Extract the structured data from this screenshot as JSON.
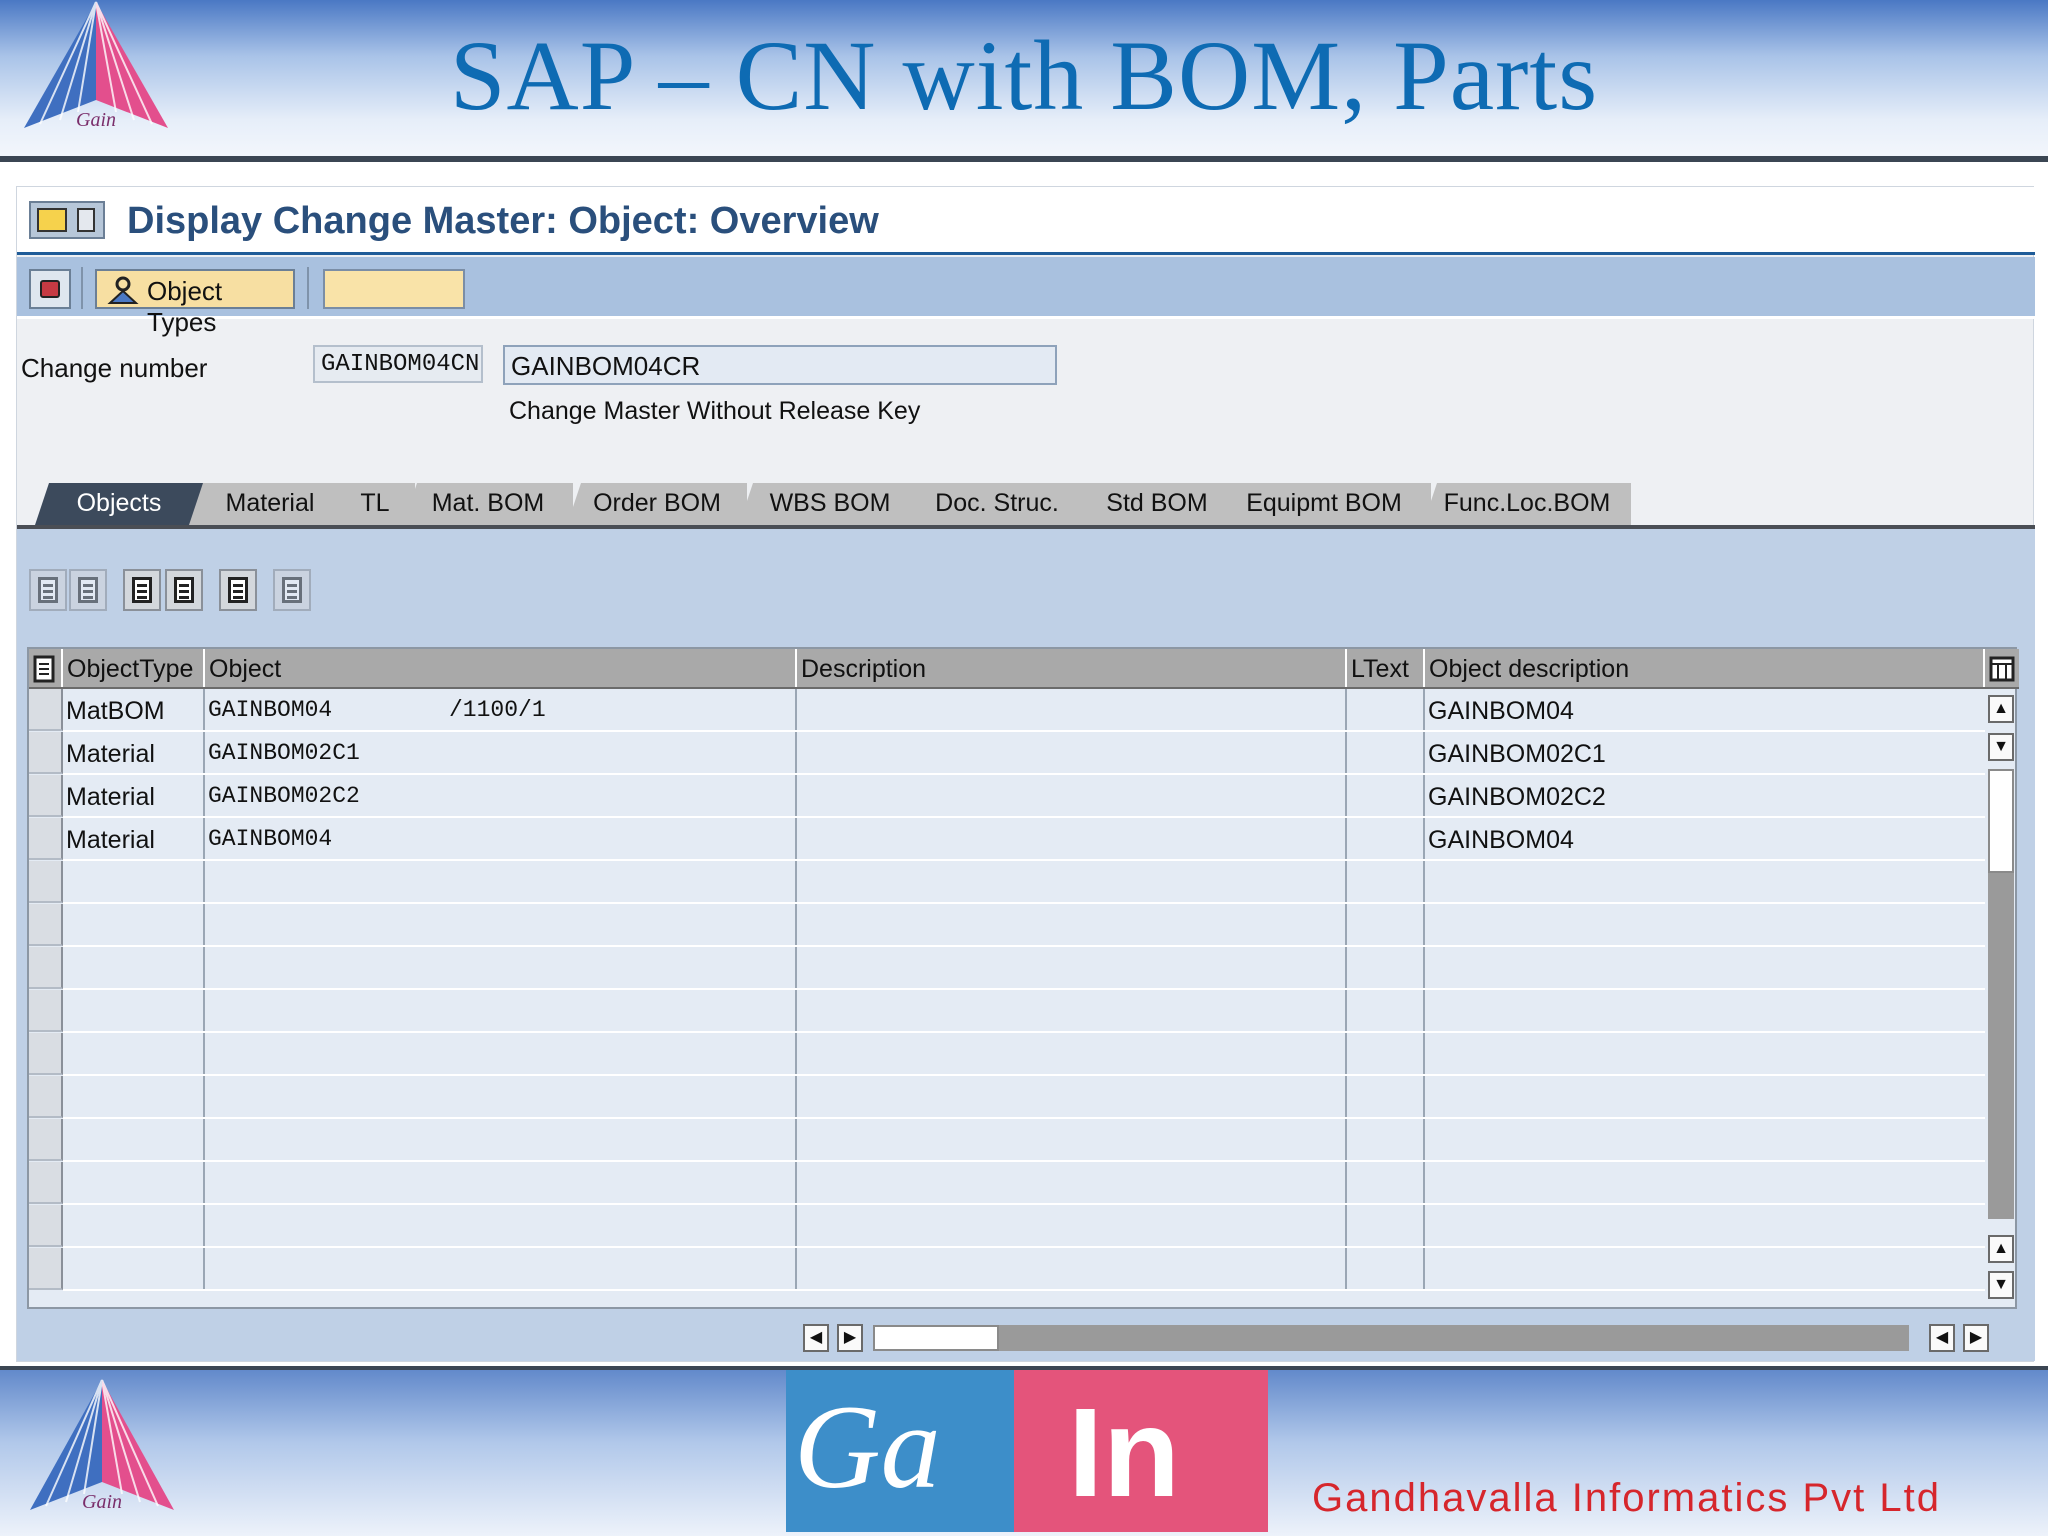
{
  "slide": {
    "title": "SAP – CN with BOM, Parts",
    "footer_company": "Gandhavalla Informatics Pvt Ltd",
    "logo_text": "Gain"
  },
  "window": {
    "title": "Display Change Master: Object: Overview"
  },
  "toolbar": {
    "object_types_label": "Object Types"
  },
  "header": {
    "change_number_label": "Change number",
    "change_number_value": "GAINBOM04CN",
    "description_value": "GAINBOM04CR",
    "type_text": "Change Master Without Release Key"
  },
  "tabs": [
    {
      "label": "Objects",
      "active": true
    },
    {
      "label": "Material"
    },
    {
      "label": "TL"
    },
    {
      "label": "Mat. BOM"
    },
    {
      "label": "Order BOM"
    },
    {
      "label": "WBS BOM"
    },
    {
      "label": "Doc. Struc."
    },
    {
      "label": "Std BOM"
    },
    {
      "label": "Equipmt BOM"
    },
    {
      "label": "Func.Loc.BOM"
    }
  ],
  "table": {
    "columns": [
      "ObjectType",
      "Object",
      "Description",
      "LText",
      "Object description"
    ],
    "rows": [
      {
        "type": "MatBOM",
        "object": "GAINBOM04",
        "object_suffix": "/1100/1",
        "description": "",
        "ltext": "",
        "object_desc": "GAINBOM04"
      },
      {
        "type": "Material",
        "object": "GAINBOM02C1",
        "object_suffix": "",
        "description": "",
        "ltext": "",
        "object_desc": "GAINBOM02C1"
      },
      {
        "type": "Material",
        "object": "GAINBOM02C2",
        "object_suffix": "",
        "description": "",
        "ltext": "",
        "object_desc": "GAINBOM02C2"
      },
      {
        "type": "Material",
        "object": "GAINBOM04",
        "object_suffix": "",
        "description": "",
        "ltext": "",
        "object_desc": "GAINBOM04"
      }
    ]
  },
  "colors": {
    "title_blue": "#0e6bb3",
    "sap_header_blue": "#2a4f7c",
    "active_tab": "#3c4a5c",
    "footer_red": "#d6262c"
  }
}
